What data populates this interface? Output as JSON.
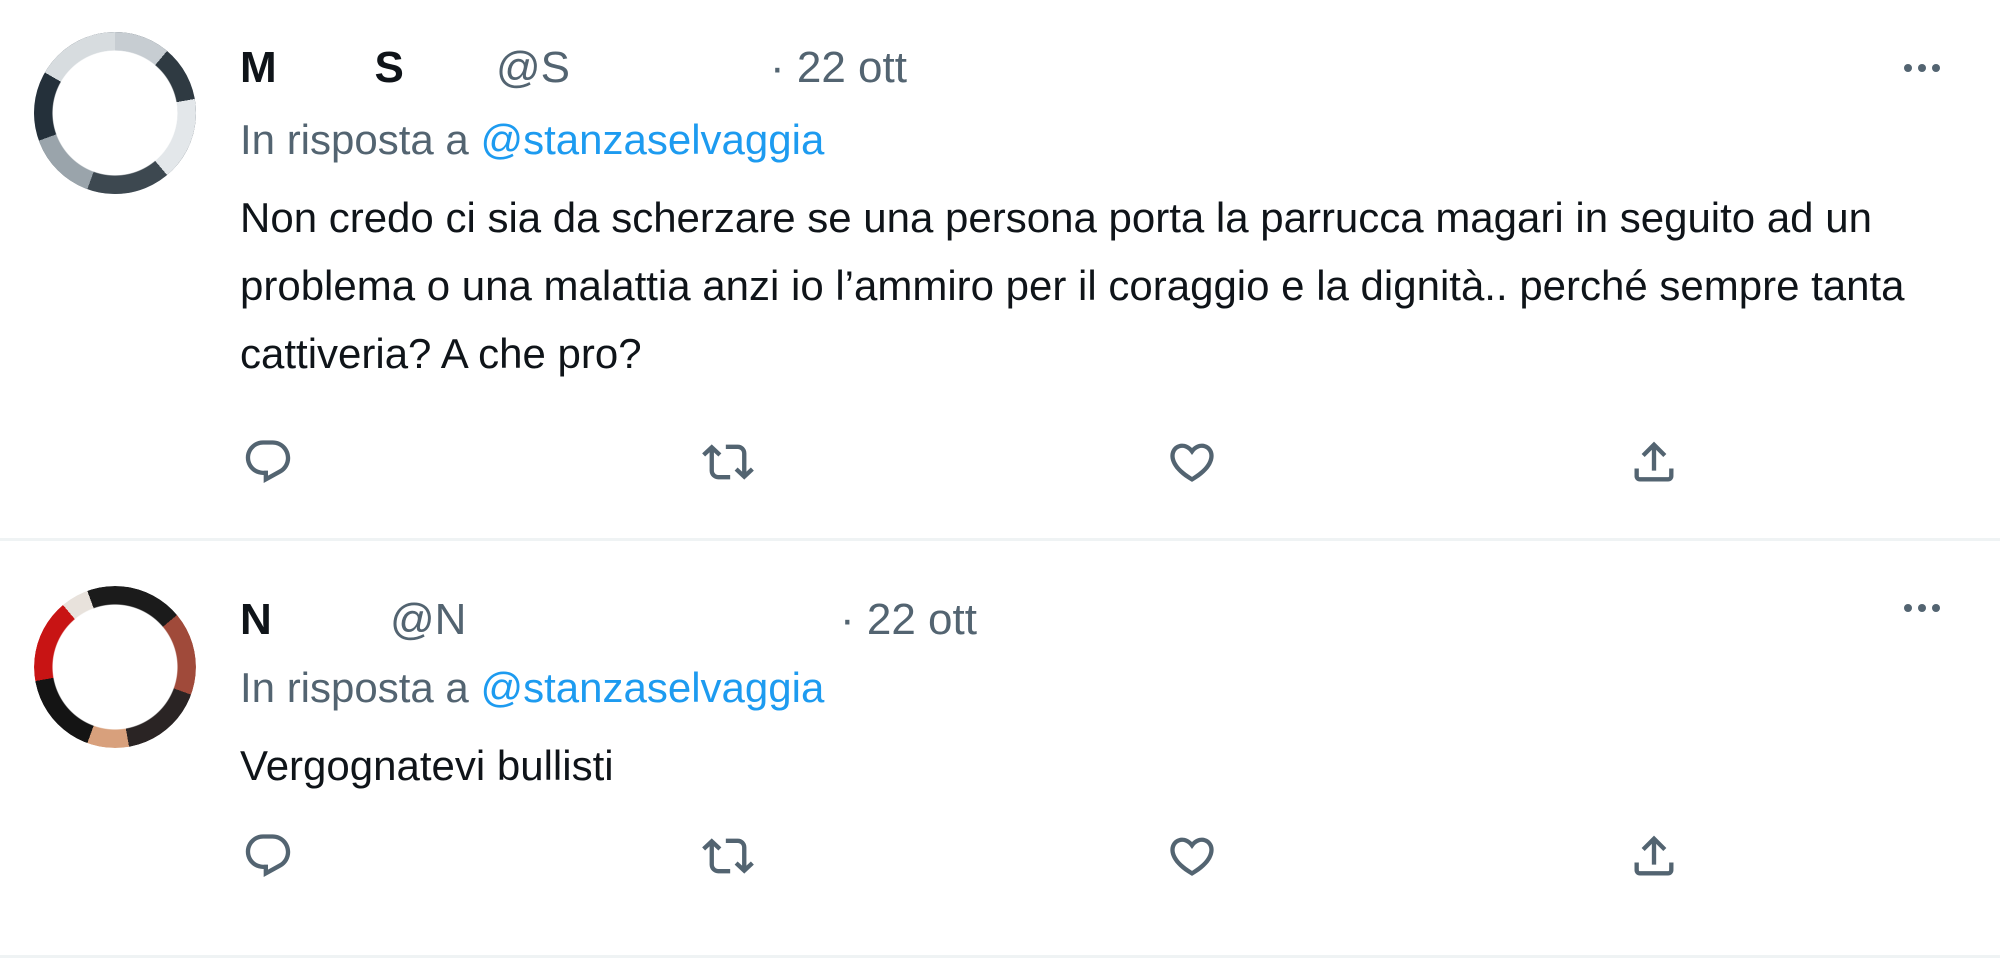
{
  "tweets": [
    {
      "name": "M        S",
      "handle": "@S",
      "date": "· 22 ott",
      "reply_prefix": "In risposta a",
      "reply_mention": "@stanzaselvaggia",
      "text": "Non credo ci sia da scherzare se una persona porta la parrucca magari in seguito ad un problema o una malattia anzi io l’ammiro per il coraggio e la dignità.. perché sempre tanta cattiveria? A che pro?"
    },
    {
      "name": "N",
      "handle": "@N",
      "date": "· 22 ott",
      "reply_prefix": "In risposta a",
      "reply_mention": "@stanzaselvaggia",
      "text": "Vergognatevi bullisti"
    }
  ],
  "icons": {
    "reply": "reply-icon",
    "retweet": "retweet-icon",
    "like": "heart-icon",
    "share": "share-icon",
    "more": "more-icon"
  },
  "colors": {
    "text": "#0f1419",
    "secondary": "#536471",
    "link": "#1d9bf0",
    "divider": "#eff3f4"
  }
}
